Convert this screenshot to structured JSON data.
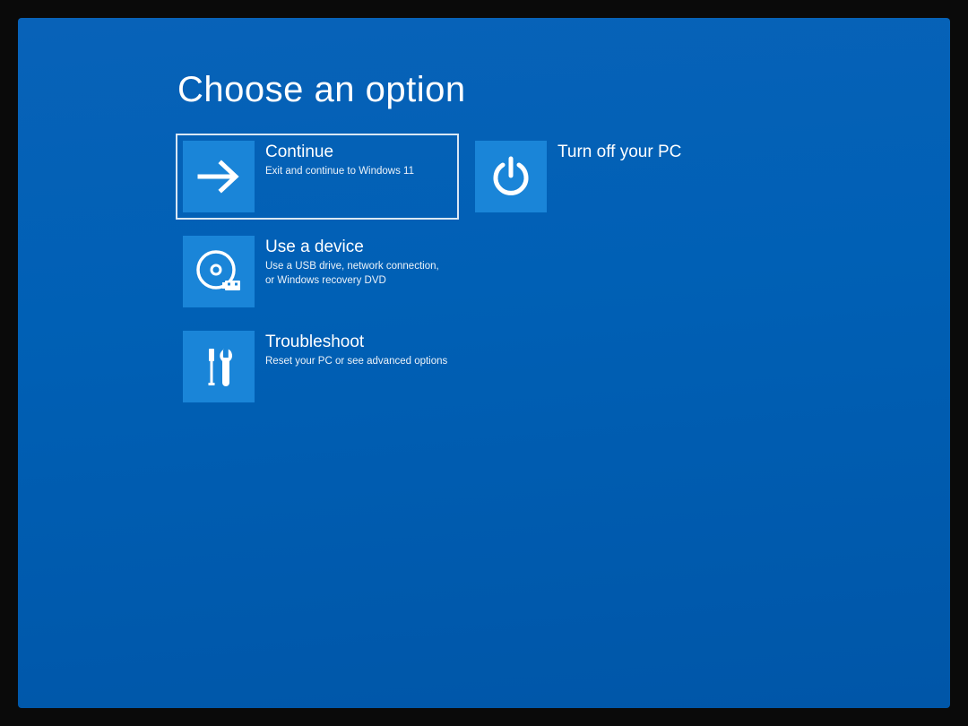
{
  "title": "Choose an option",
  "options": [
    {
      "id": "continue",
      "title": "Continue",
      "desc": "Exit and continue to Windows 11",
      "icon": "arrow-right-icon",
      "selected": true,
      "col": 1
    },
    {
      "id": "turn-off",
      "title": "Turn off your PC",
      "desc": "",
      "icon": "power-icon",
      "selected": false,
      "col": 2
    },
    {
      "id": "use-device",
      "title": "Use a device",
      "desc": "Use a USB drive, network connection, or Windows recovery DVD",
      "icon": "disc-usb-icon",
      "selected": false,
      "col": 1
    },
    {
      "id": "troubleshoot",
      "title": "Troubleshoot",
      "desc": "Reset your PC or see advanced options",
      "icon": "tools-icon",
      "selected": false,
      "col": 1
    }
  ],
  "colors": {
    "background": "#005eb3",
    "tile": "#1a85d8",
    "text": "#ffffff"
  }
}
